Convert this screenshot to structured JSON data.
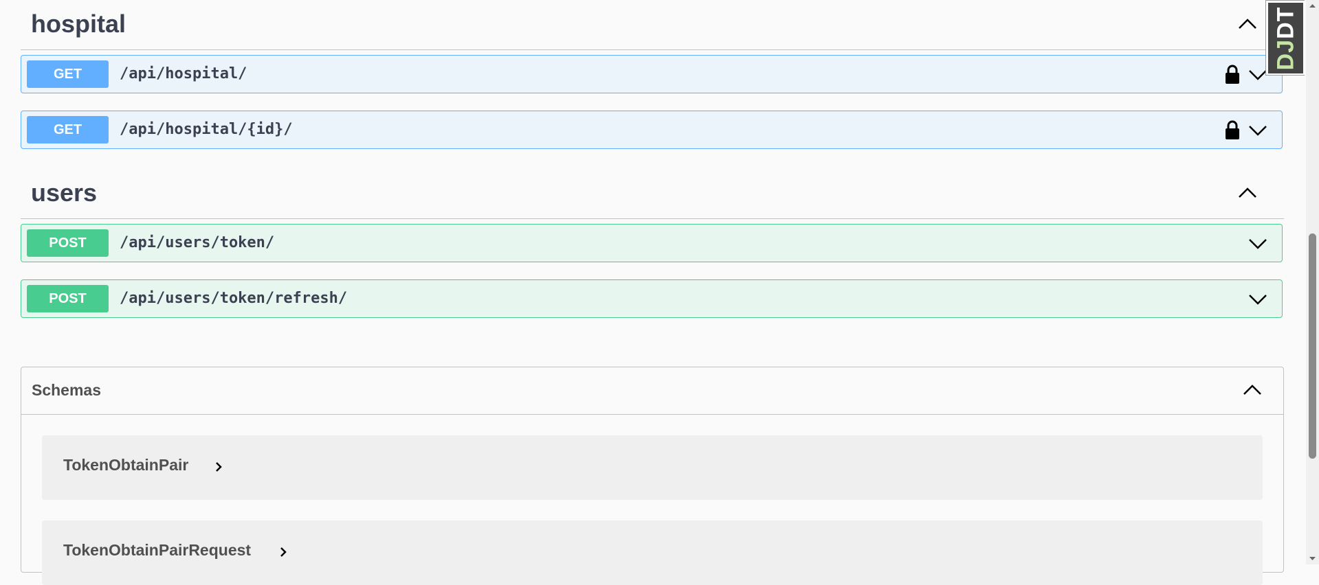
{
  "sections": [
    {
      "name": "hospital",
      "operations": [
        {
          "method": "GET",
          "path": "/api/hospital/",
          "locked": true
        },
        {
          "method": "GET",
          "path": "/api/hospital/{id}/",
          "locked": true
        }
      ]
    },
    {
      "name": "users",
      "operations": [
        {
          "method": "POST",
          "path": "/api/users/token/",
          "locked": false
        },
        {
          "method": "POST",
          "path": "/api/users/token/refresh/",
          "locked": false
        }
      ]
    }
  ],
  "schemas": {
    "title": "Schemas",
    "models": [
      "TokenObtainPair",
      "TokenObtainPairRequest"
    ]
  },
  "debug_toolbar": {
    "dj": "DJ",
    "dt": "DT"
  },
  "colors": {
    "get": "#61affe",
    "post": "#49cc90",
    "text": "#3b4151"
  },
  "icons": {
    "lock": "lock-icon",
    "chevron_down": "chevron-down-icon",
    "chevron_up": "chevron-up-icon",
    "chevron_right": "chevron-right-icon"
  }
}
